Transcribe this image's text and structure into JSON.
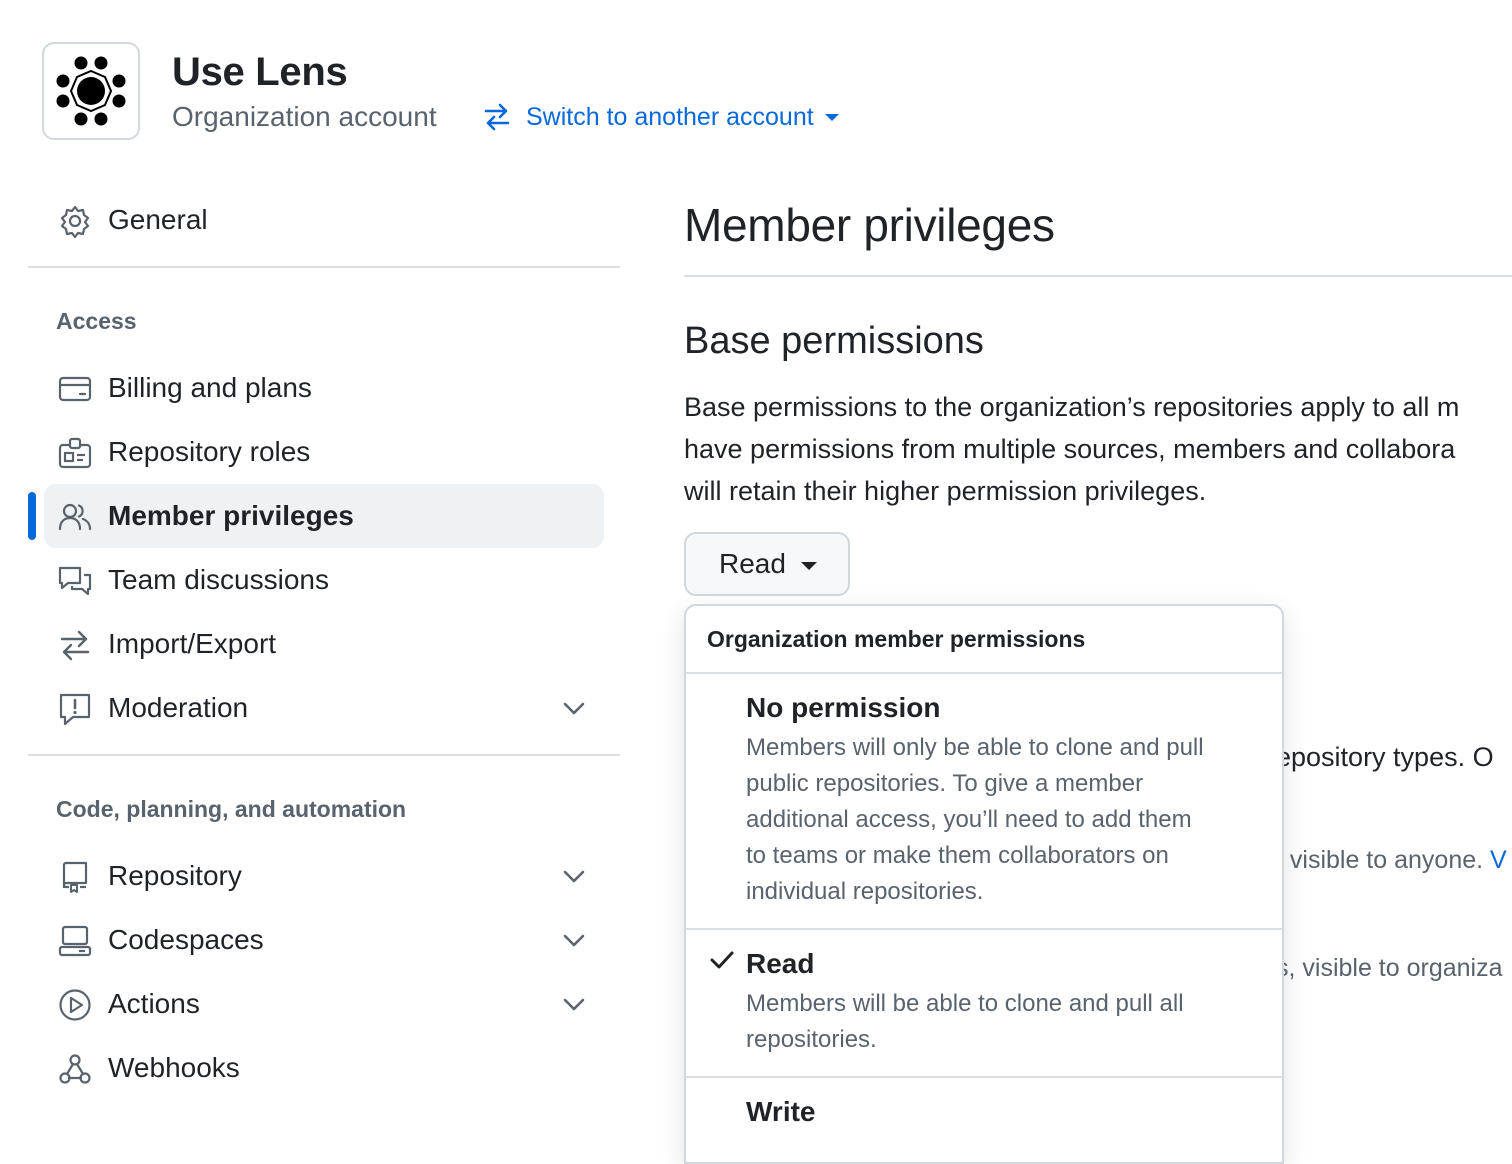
{
  "header": {
    "org_name": "Use Lens",
    "org_type": "Organization account",
    "switch_label": "Switch to another account"
  },
  "sidebar": {
    "general": "General",
    "access_heading": "Access",
    "access_items": [
      {
        "label": "Billing and plans",
        "icon": "credit-card-icon"
      },
      {
        "label": "Repository roles",
        "icon": "id-badge-icon"
      },
      {
        "label": "Member privileges",
        "icon": "people-icon",
        "active": true
      },
      {
        "label": "Team discussions",
        "icon": "comment-discussion-icon"
      },
      {
        "label": "Import/Export",
        "icon": "arrow-switch-icon"
      },
      {
        "label": "Moderation",
        "icon": "report-icon"
      }
    ],
    "code_heading": "Code, planning, and automation",
    "code_items": [
      {
        "label": "Repository",
        "icon": "repo-icon"
      },
      {
        "label": "Codespaces",
        "icon": "codespaces-icon"
      },
      {
        "label": "Actions",
        "icon": "play-icon"
      },
      {
        "label": "Webhooks",
        "icon": "webhook-icon"
      }
    ]
  },
  "main": {
    "title": "Member privileges",
    "base_title": "Base permissions",
    "base_desc_lines": [
      "Base permissions to the organization’s repositories apply to all m",
      "have permissions from multiple sources, members and collabora",
      "will retain their higher permission privileges."
    ],
    "selected_permission": "Read",
    "background_text": {
      "repo_types": "epository types. O",
      "visible_anyone": ", visible to anyone. ",
      "visible_anyone_link": "V",
      "visible_org": "s, visible to organiza"
    }
  },
  "dropdown": {
    "header": "Organization member permissions",
    "options": [
      {
        "title": "No permission",
        "desc_lines": [
          "Members will only be able to clone and pull",
          "public repositories. To give a member",
          "additional access, you’ll need to add them",
          "to teams or make them collaborators on",
          "individual repositories."
        ],
        "selected": false
      },
      {
        "title": "Read",
        "desc_lines": [
          "Members will be able to clone and pull all",
          "repositories."
        ],
        "selected": true
      },
      {
        "title": "Write",
        "desc_lines": [],
        "selected": false
      }
    ]
  },
  "colors": {
    "accent": "#0969da",
    "text": "#1f2328",
    "muted": "#59636e",
    "border": "#d0d7de",
    "active_bg": "#eff2f5"
  }
}
